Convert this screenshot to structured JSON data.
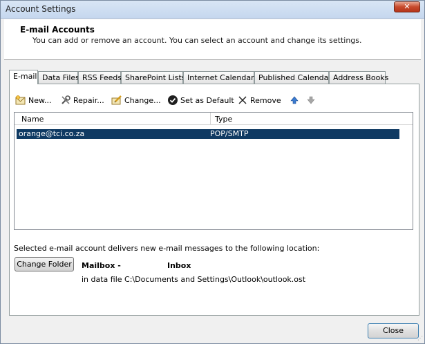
{
  "window": {
    "title": "Account Settings",
    "close_glyph": "✕"
  },
  "header": {
    "title": "E-mail Accounts",
    "description": "You can add or remove an account. You can select an account and change its settings."
  },
  "tabs": [
    {
      "label": "E-mail",
      "active": true
    },
    {
      "label": "Data Files"
    },
    {
      "label": "RSS Feeds"
    },
    {
      "label": "SharePoint Lists"
    },
    {
      "label": "Internet Calendars"
    },
    {
      "label": "Published Calendars"
    },
    {
      "label": "Address Books"
    }
  ],
  "toolbar": {
    "new_label": "New...",
    "repair_label": "Repair...",
    "change_label": "Change...",
    "default_label": "Set as Default",
    "remove_label": "Remove",
    "icons": [
      "new-account-icon",
      "repair-icon",
      "change-icon",
      "checkmark-icon",
      "remove-x-icon",
      "move-up-icon",
      "move-down-icon"
    ]
  },
  "list": {
    "columns": [
      "Name",
      "Type"
    ],
    "rows": [
      {
        "name": "orange@tci.co.za",
        "type": "POP/SMTP",
        "selected": true
      }
    ]
  },
  "delivery": {
    "text": "Selected e-mail account delivers new e-mail messages to the following location:",
    "change_folder_label": "Change Folder",
    "mailbox_label": "Mailbox -",
    "inbox_label": "Inbox",
    "data_file_text": "in data file C:\\Documents and Settings\\Outlook\\outlook.ost"
  },
  "footer": {
    "close_label": "Close"
  },
  "colors": {
    "selection": "#0f3a63",
    "accent": "#3c7fb1"
  }
}
